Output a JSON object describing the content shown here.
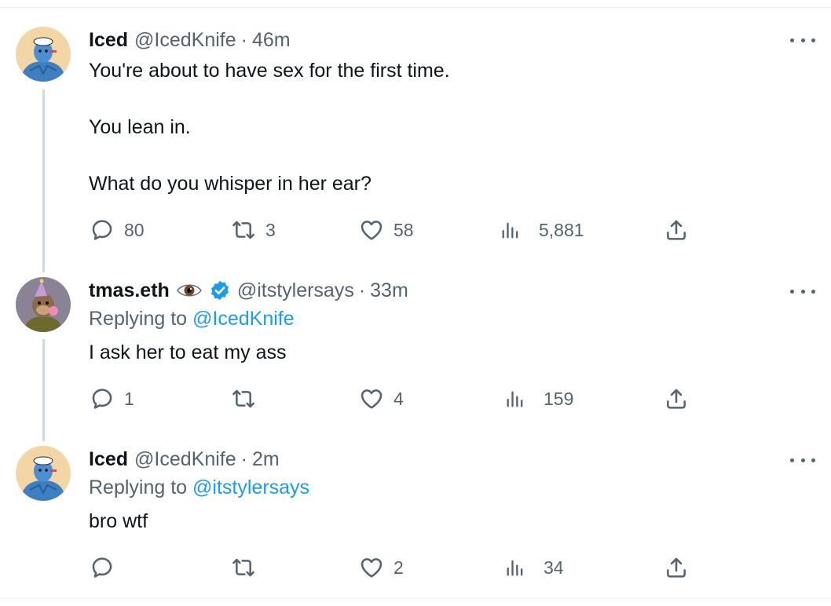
{
  "tweets": [
    {
      "name": "Iced",
      "handle": "@IcedKnife",
      "separator": "·",
      "time": "46m",
      "lines": [
        "You're about to have sex for the first time.",
        "You lean in.",
        "What do you whisper in her ear?"
      ],
      "stats": {
        "replies": "80",
        "retweets": "3",
        "likes": "58",
        "views": "5,881"
      }
    },
    {
      "name": "tmas.eth",
      "handle": "@itstylersays",
      "separator": "·",
      "time": "33m",
      "verified": true,
      "reply_prefix": "Replying to",
      "reply_to": "@IcedKnife",
      "lines": [
        "I ask her to eat my ass"
      ],
      "stats": {
        "replies": "1",
        "retweets": "",
        "likes": "4",
        "views": "159"
      }
    },
    {
      "name": "Iced",
      "handle": "@IcedKnife",
      "separator": "·",
      "time": "2m",
      "reply_prefix": "Replying to",
      "reply_to": "@itstylersays",
      "lines": [
        "bro wtf"
      ],
      "stats": {
        "replies": "",
        "retweets": "",
        "likes": "2",
        "views": "34"
      }
    }
  ],
  "colors": {
    "text": "#0f1419",
    "secondary": "#536471",
    "link": "#1d9bf0",
    "verified": "#1d9bf0",
    "thread_line": "#cfd9de"
  },
  "icons": [
    "reply-icon",
    "retweet-icon",
    "like-icon",
    "views-icon",
    "share-icon",
    "more-icon",
    "verified-badge-icon",
    "eye-emoji-icon"
  ]
}
